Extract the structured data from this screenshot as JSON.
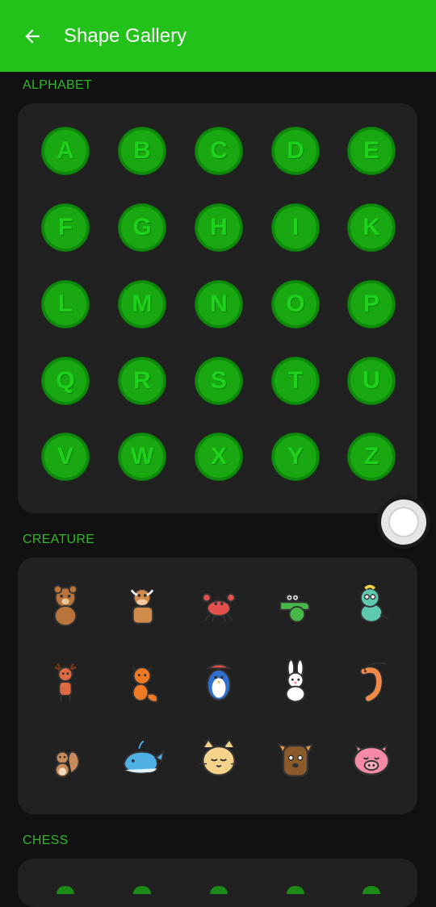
{
  "appbar": {
    "title": "Shape Gallery",
    "back_icon": "arrow-left-icon"
  },
  "sections": {
    "alphabet": {
      "label": "ALPHABET"
    },
    "creature": {
      "label": "CREATURE"
    },
    "chess": {
      "label": "CHESS"
    }
  },
  "alphabet": [
    "A",
    "B",
    "C",
    "D",
    "E",
    "F",
    "G",
    "H",
    "I",
    "K",
    "L",
    "M",
    "N",
    "O",
    "P",
    "Q",
    "R",
    "S",
    "T",
    "U",
    "V",
    "W",
    "X",
    "Y",
    "Z"
  ],
  "creatures": [
    "bear-icon",
    "cow-icon",
    "crab-icon",
    "crocodile-icon",
    "dinosaur-icon",
    "deer-icon",
    "fox-icon",
    "penguin-icon",
    "rabbit-icon",
    "shrimp-icon",
    "squirrel-icon",
    "whale-icon",
    "cat-icon",
    "dog-icon",
    "pig-icon"
  ],
  "colors": {
    "accent": "#22c21a",
    "background": "#111111",
    "card": "#212121",
    "section_label": "#33b52b",
    "letter_fill": "#19a812",
    "letter_text": "#1ed11a"
  }
}
